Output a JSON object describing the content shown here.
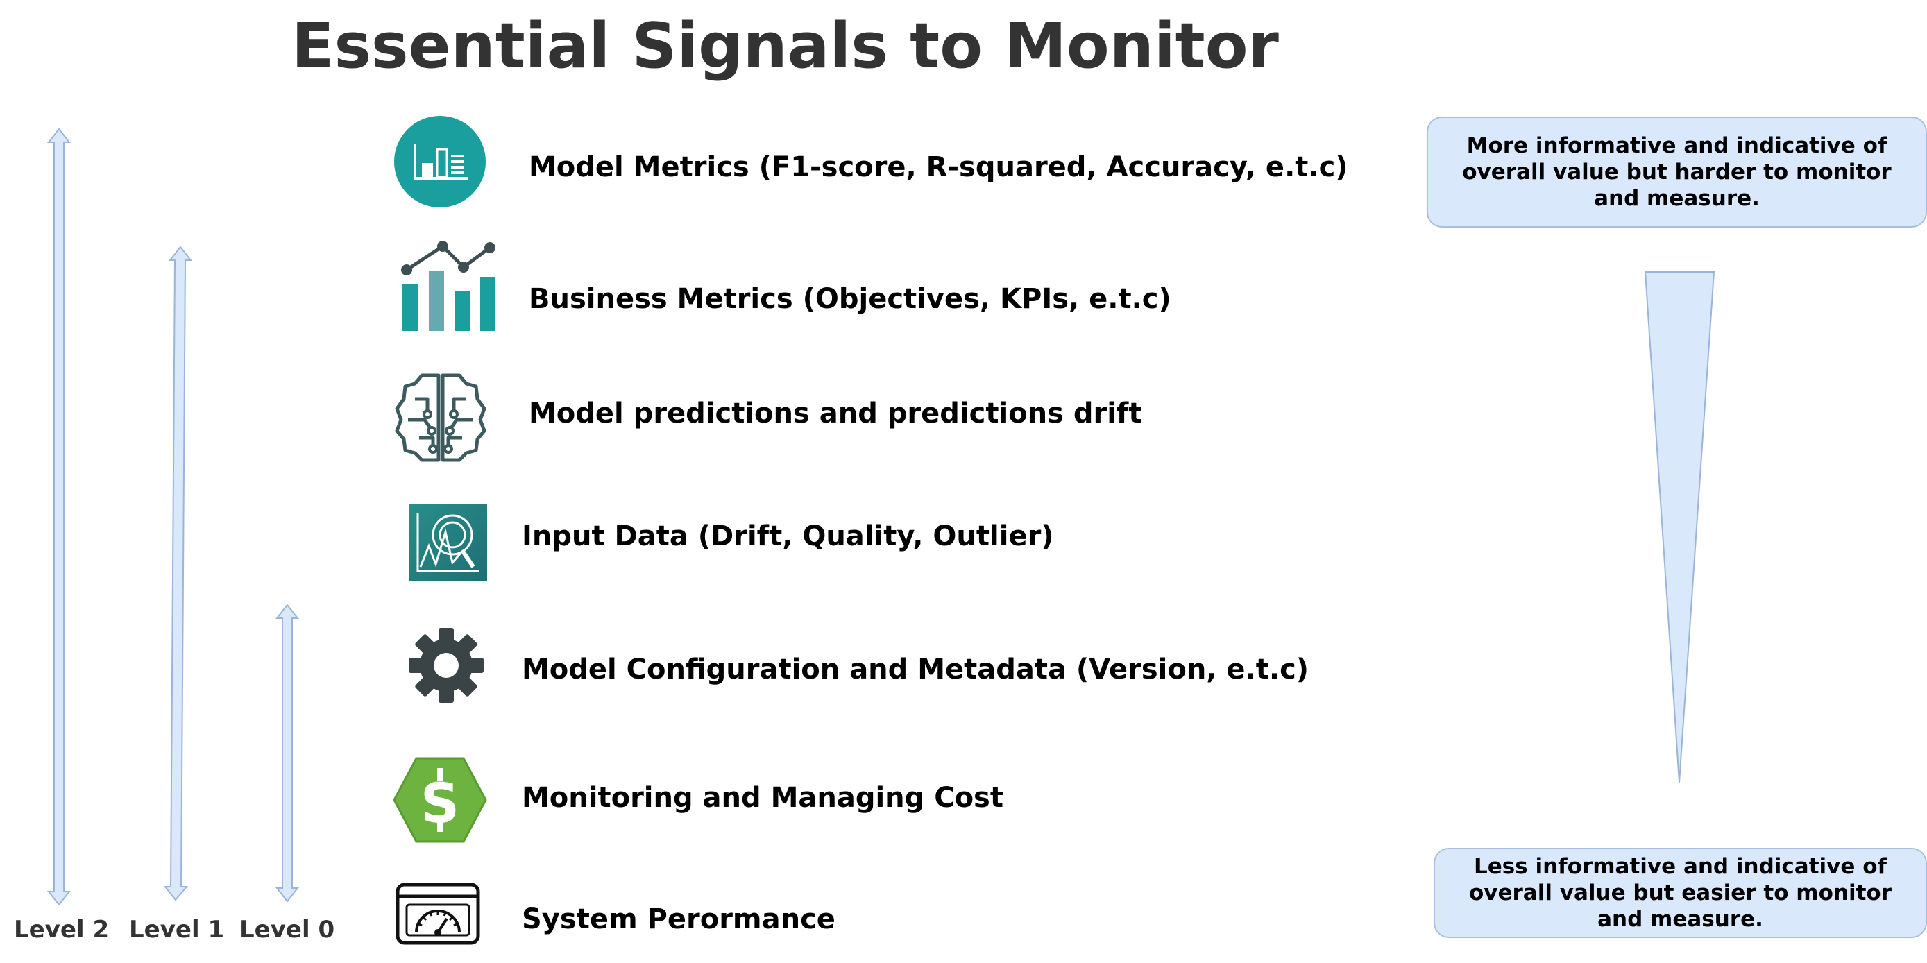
{
  "title": "Essential Signals to Monitor",
  "items": [
    {
      "label": "Model Metrics (F1-score, R-squared, Accuracy, e.t.c)",
      "icon": "bar-chart-circle-icon"
    },
    {
      "label": "Business Metrics (Objectives, KPIs, e.t.c)",
      "icon": "trend-bar-chart-icon"
    },
    {
      "label": "Model predictions and predictions drift",
      "icon": "brain-circuit-icon"
    },
    {
      "label": "Input Data (Drift, Quality, Outlier)",
      "icon": "data-search-icon"
    },
    {
      "label": "Model Configuration and Metadata (Version, e.t.c)",
      "icon": "gear-icon"
    },
    {
      "label": "Monitoring and Managing Cost",
      "icon": "dollar-hexagon-icon"
    },
    {
      "label": "System Perormance",
      "icon": "dashboard-gauge-icon"
    }
  ],
  "levels": [
    "Level 2",
    "Level 1",
    "Level 0"
  ],
  "top_note": "More informative and indicative of overall value but harder to monitor and measure.",
  "bottom_note": "Less informative and indicative of overall value but easier to monitor and measure.",
  "colors": {
    "teal": "#1a9e9e",
    "dark_slate": "#3d4f52",
    "green": "#6db33f",
    "light_blue": "#dae8fc",
    "arrow_stroke": "#9ab5d9",
    "title": "#333333"
  }
}
